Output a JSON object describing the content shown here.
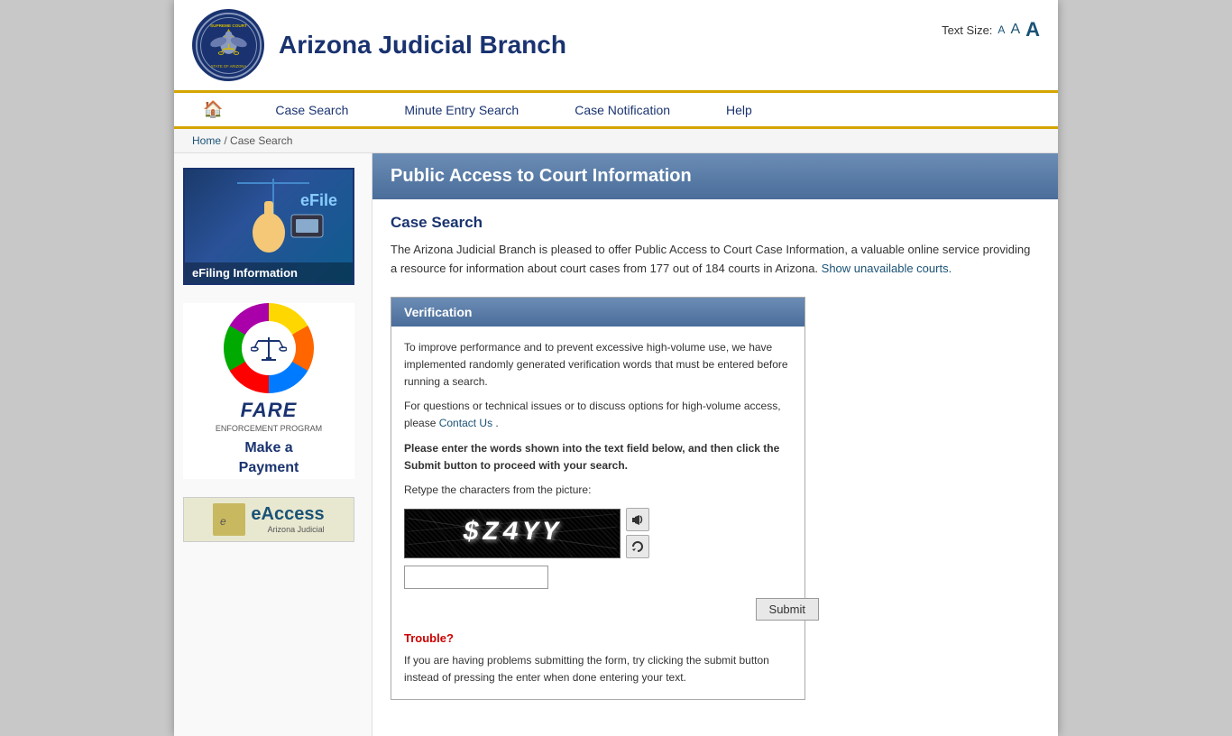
{
  "header": {
    "title": "Arizona Judicial Branch",
    "text_size_label": "Text Size:",
    "text_size_small": "A",
    "text_size_medium": "A",
    "text_size_large": "A"
  },
  "nav": {
    "home_label": "Home",
    "items": [
      {
        "label": "Case Search",
        "id": "case-search"
      },
      {
        "label": "Minute Entry Search",
        "id": "minute-entry-search"
      },
      {
        "label": "Case Notification",
        "id": "case-notification"
      },
      {
        "label": "Help",
        "id": "help"
      }
    ]
  },
  "breadcrumb": {
    "home": "Home",
    "separator": "/",
    "current": "Case Search"
  },
  "sidebar": {
    "efiling_label": "eFiling  Information",
    "efiling_text": "eFile",
    "fare_title": "FARE",
    "fare_subtitle": "ENFORCEMENT PROGRAM",
    "fare_payment_line1": "Make a",
    "fare_payment_line2": "Payment",
    "eaccess_text": "eAccess",
    "eaccess_label": "Arizona Judicial"
  },
  "content": {
    "page_title": "Public Access to Court Information",
    "section_title": "Case Search",
    "description": "The Arizona Judicial Branch is pleased to offer Public Access to Court Case Information, a valuable online service providing a resource for information about court cases from 177 out of 184 courts in Arizona.",
    "unavailable_courts_link": "Show unavailable courts.",
    "verification": {
      "title": "Verification",
      "body_text_1": "To improve performance and to prevent excessive high-volume use, we have implemented randomly generated verification words that must be entered before running a search.",
      "body_text_2": "For questions or technical issues or to discuss options for high-volume access, please",
      "contact_link": "Contact Us",
      "body_text_3": ".",
      "instruction": "Please enter the words shown into the text field below, and then click the Submit button to proceed with your search.",
      "retype_label": "Retype the characters from the picture:",
      "captcha_value": "$Z4YY",
      "submit_label": "Submit",
      "captcha_input_placeholder": ""
    },
    "trouble": {
      "title": "Trouble?",
      "text": "If you are having problems submitting the form, try clicking the submit button instead of pressing the enter when done entering your text."
    }
  }
}
